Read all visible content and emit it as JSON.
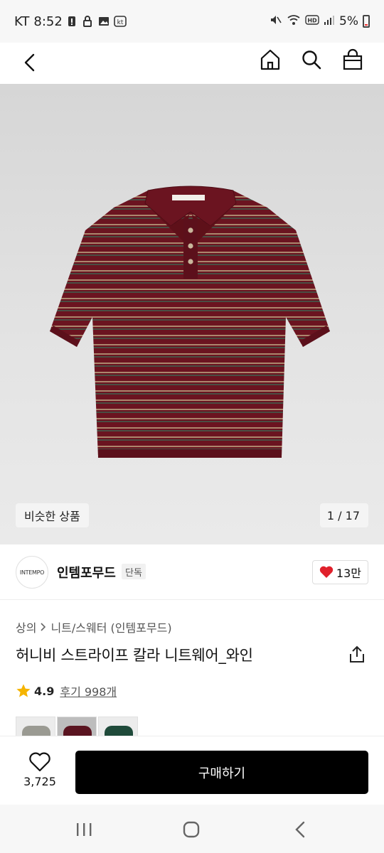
{
  "status_bar": {
    "carrier": "KT",
    "time": "8:52",
    "battery": "5%"
  },
  "header": {
    "icons": [
      "back-icon",
      "home-icon",
      "search-icon",
      "shopping-bag-icon"
    ]
  },
  "gallery": {
    "similar_label": "비슷한 상품",
    "pager": "1 / 17",
    "product_colors": {
      "knit_base": "#6b1420",
      "stripe_light": "#b89a7a",
      "stripe_dark": "#3f6150"
    }
  },
  "brand": {
    "logo_text": "INTEMPO",
    "name": "인템포무드",
    "badge": "단독",
    "likes": "13만"
  },
  "product": {
    "breadcrumb": [
      "상의",
      "니트/스웨터 (인템포무드)"
    ],
    "title": "허니비 스트라이프 칼라 니트웨어_와인",
    "rating": "4.9",
    "reviews": "후기 998개"
  },
  "swatches": [
    {
      "color": "#9a9a92"
    },
    {
      "color": "#5a1420"
    },
    {
      "color": "#1f4a3a"
    }
  ],
  "purchase": {
    "wish_count": "3,725",
    "buy_label": "구매하기"
  },
  "system_nav": [
    "recents-icon",
    "home-icon",
    "back-icon"
  ]
}
